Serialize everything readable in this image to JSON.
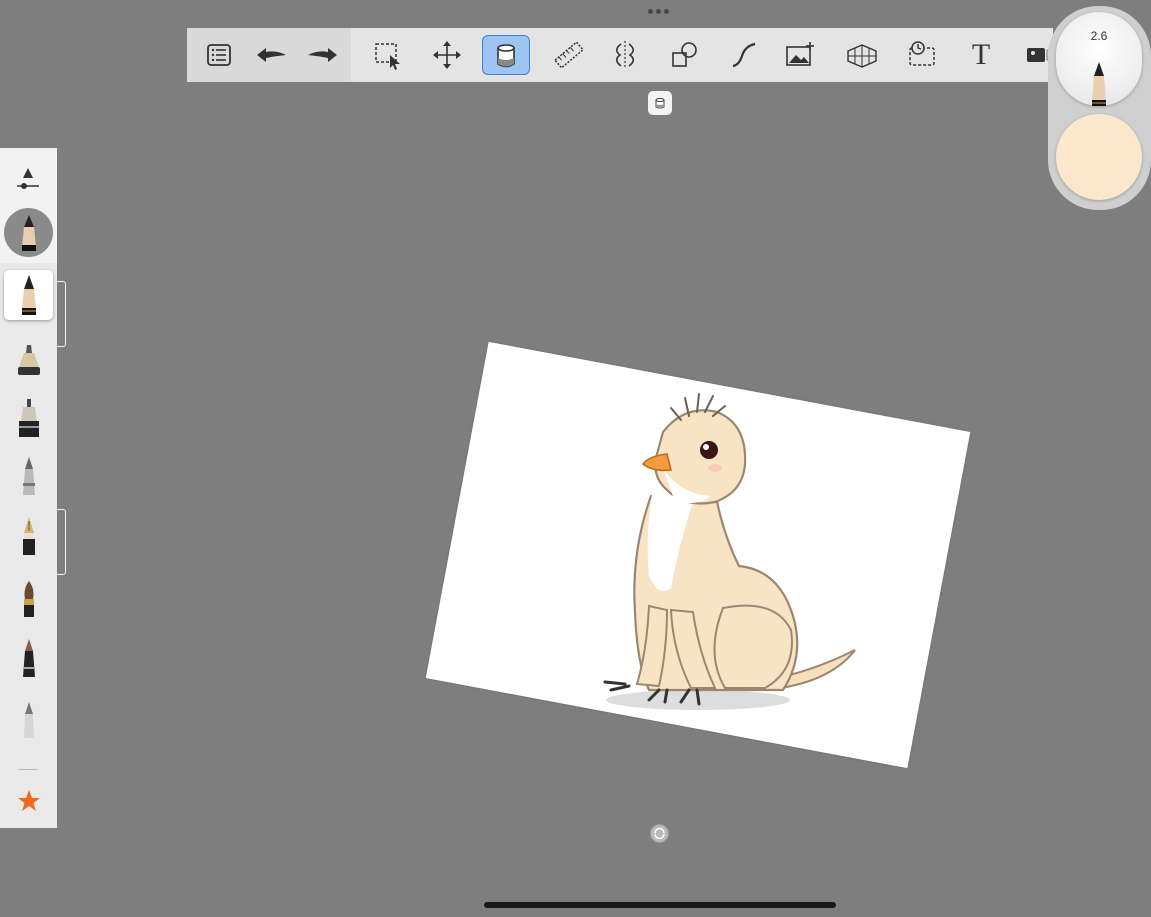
{
  "top_toolbar": {
    "tools": [
      {
        "name": "brush-library-icon"
      },
      {
        "name": "undo-icon"
      },
      {
        "name": "redo-icon"
      },
      {
        "name": "selection-icon"
      },
      {
        "name": "transform-icon"
      },
      {
        "name": "fill-icon",
        "active": true
      },
      {
        "name": "ruler-icon"
      },
      {
        "name": "symmetry-icon"
      },
      {
        "name": "shape-icon"
      },
      {
        "name": "curve-icon"
      },
      {
        "name": "import-image-icon"
      },
      {
        "name": "perspective-guide-icon"
      },
      {
        "name": "timelapse-icon"
      },
      {
        "name": "text-icon",
        "label": "T"
      },
      {
        "name": "camera-icon"
      }
    ]
  },
  "brush_puck": {
    "size": "2.6",
    "color": "#fbe8cc"
  },
  "left_panel": {
    "brushes": [
      {
        "name": "pencil-brush",
        "selected": true
      },
      {
        "name": "ink-brush"
      },
      {
        "name": "technical-pen-brush"
      },
      {
        "name": "ballpoint-brush"
      },
      {
        "name": "fountain-pen-brush"
      },
      {
        "name": "paint-brush"
      },
      {
        "name": "marker-brush"
      },
      {
        "name": "airbrush-brush"
      }
    ],
    "favorites_icon": "star-icon",
    "favorites_color": "#f06a1e"
  },
  "canvas": {
    "rotation_deg": 10.6
  }
}
